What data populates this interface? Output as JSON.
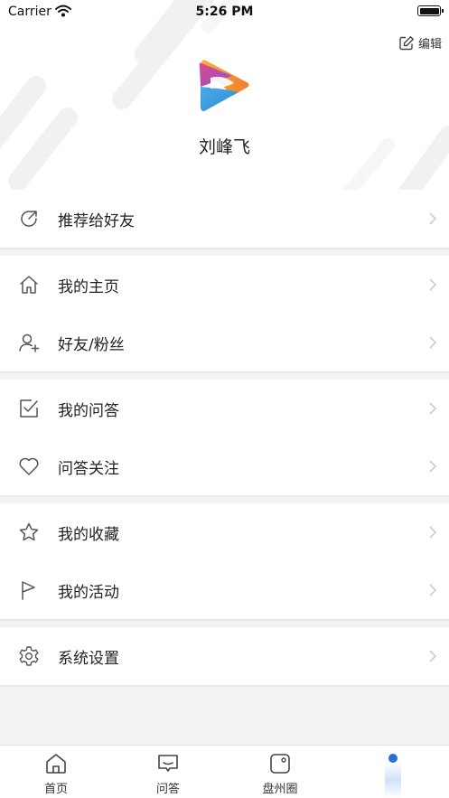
{
  "status_bar": {
    "carrier": "Carrier",
    "time": "5:26 PM"
  },
  "header": {
    "edit_label": "编辑",
    "username": "刘峰飞"
  },
  "menu": {
    "groups": [
      {
        "items": [
          {
            "label": "推荐给好友",
            "icon": "share-icon"
          }
        ]
      },
      {
        "items": [
          {
            "label": "我的主页",
            "icon": "home-icon"
          },
          {
            "label": "好友/粉丝",
            "icon": "add-friend-icon"
          }
        ]
      },
      {
        "items": [
          {
            "label": "我的问答",
            "icon": "checkbox-icon"
          },
          {
            "label": "问答关注",
            "icon": "heart-icon"
          }
        ]
      },
      {
        "items": [
          {
            "label": "我的收藏",
            "icon": "star-icon"
          },
          {
            "label": "我的活动",
            "icon": "flag-icon"
          }
        ]
      },
      {
        "items": [
          {
            "label": "系统设置",
            "icon": "gear-icon"
          }
        ]
      }
    ]
  },
  "tab_bar": {
    "tabs": [
      {
        "label": "首页",
        "icon": "home-tab-icon"
      },
      {
        "label": "问答",
        "icon": "chat-tab-icon"
      },
      {
        "label": "盘州圈",
        "icon": "circle-tab-icon"
      },
      {
        "label": "",
        "icon": "profile-tab-indicator"
      }
    ]
  },
  "colors": {
    "accent": "#2d6fd6",
    "background": "#f3f3f4"
  }
}
